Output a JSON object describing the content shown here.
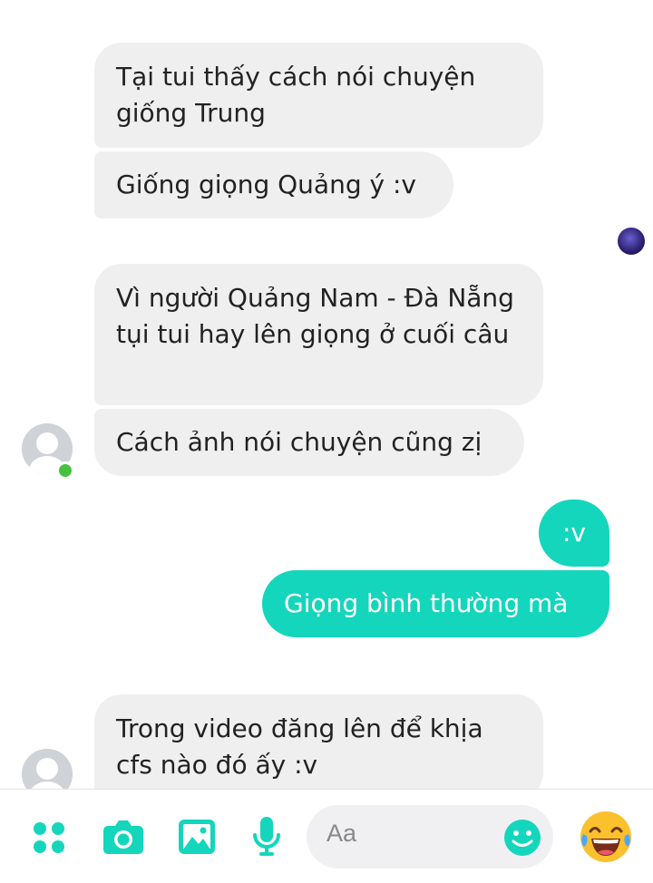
{
  "messages": [
    {
      "side": "in",
      "text": "Tại tui thấy cách nói chuyện giống Trung"
    },
    {
      "side": "in",
      "text": "Giống giọng Quảng ý :v"
    },
    {
      "side": "in",
      "text": "Vì người Quảng Nam - Đà Nẵng tụi tui hay lên giọng ở cuối câu"
    },
    {
      "side": "in",
      "text": "Cách ảnh nói chuyện cũng zị"
    },
    {
      "side": "out",
      "text": ":v"
    },
    {
      "side": "out",
      "text": "Giọng bình thường mà"
    },
    {
      "side": "in",
      "text": "Trong video đăng lên để khịa cfs nào đó ấy :v"
    }
  ],
  "composer": {
    "placeholder": "Aa",
    "icons": [
      "apps-icon",
      "camera-icon",
      "gallery-icon",
      "microphone-icon",
      "emoji-icon",
      "laughing-emoji-icon"
    ]
  },
  "colors": {
    "accent": "#14d6bc",
    "incoming_bubble": "#efeff0",
    "online": "#44c23d"
  }
}
